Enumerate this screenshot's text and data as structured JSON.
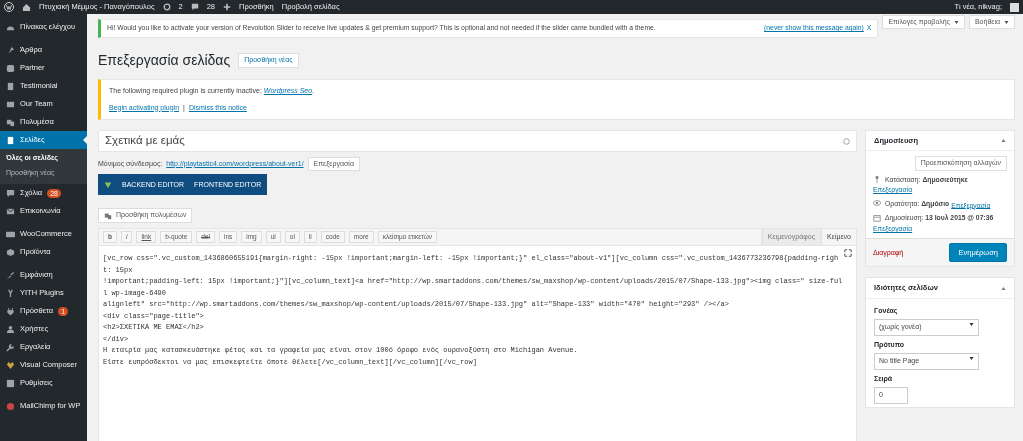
{
  "admin_bar": {
    "site_title": "Πτυχιακή Μέμμος - Παναγόπουλος",
    "updates": "2",
    "comments": "28",
    "new_label": "Προσθήκη",
    "view_label": "Προβολή σελίδας",
    "greeting": "Τι νέα, nikvag;"
  },
  "sidebar": {
    "items": [
      {
        "label": "Πίνακας ελέγχου",
        "selected": false
      },
      {
        "label": "Άρθρα",
        "selected": false
      },
      {
        "label": "Partner",
        "selected": false
      },
      {
        "label": "Testimonial",
        "selected": false
      },
      {
        "label": "Our Team",
        "selected": false
      },
      {
        "label": "Πολυμέσα",
        "selected": false
      },
      {
        "label": "Σελίδες",
        "selected": true,
        "children": [
          {
            "label": "Όλες οι σελίδες",
            "selected": true
          },
          {
            "label": "Προσθήκη νέας",
            "selected": false
          }
        ]
      },
      {
        "label": "Σχόλια",
        "selected": false,
        "badge": "28"
      },
      {
        "label": "Επικοινωνία",
        "selected": false
      },
      {
        "label": "WooCommerce",
        "selected": false
      },
      {
        "label": "Προϊόντα",
        "selected": false
      },
      {
        "label": "Εμφάνιση",
        "selected": false
      },
      {
        "label": "YITH Plugins",
        "selected": false
      },
      {
        "label": "Πρόσθετα",
        "selected": false,
        "badge": "1"
      },
      {
        "label": "Χρήστες",
        "selected": false
      },
      {
        "label": "Εργαλεία",
        "selected": false
      },
      {
        "label": "Visual Composer",
        "selected": false
      },
      {
        "label": "Ρυθμίσεις",
        "selected": false
      },
      {
        "label": "MailChimp for WP",
        "selected": false
      }
    ]
  },
  "slider_notice": {
    "text": "Hi! Would you like to activate your version of Revolution Slider to receive live updates & get premium support? This is optional and not needed if the slider came bundled with a theme.",
    "dismiss_link": "(never show this message again)",
    "close": "X"
  },
  "screen_options": "Επιλογές προβολής",
  "help": "Βοήθεια",
  "heading": "Επεξεργασία σελίδας",
  "add_new": "Προσθήκη νέας",
  "plugin_notice": {
    "text": "The following required plugin is currently inactive: ",
    "plugin_link": "Wordpress Seo",
    "text_end": ".",
    "begin_link": "Begin activating plugin",
    "separator": "|",
    "dismiss_link": "Dismiss this notice"
  },
  "title_value": "Σχετικά με εμάς",
  "permalink": {
    "label": "Μόνιμος σύνδεσμος:",
    "url": "http://playtastic4.com/wordpress/about-ver1/",
    "edit": "Επεξεργασία"
  },
  "composer_tabs": [
    "BACKEND EDITOR",
    "FRONTEND EDITOR"
  ],
  "add_media": "Προσθήκη πολυμέσων",
  "quicktags": [
    "b",
    "i",
    "link",
    "b-quote",
    "del",
    "ins",
    "img",
    "ul",
    "ol",
    "li",
    "code",
    "more",
    "κλείσιμο ετικετών"
  ],
  "editor_tabs": [
    {
      "label": "Κειμενογράφος",
      "selected": false
    },
    {
      "label": "Κείμενο",
      "selected": true
    }
  ],
  "editor_lines": [
    "[vc_row css=\".vc_custom_1436860655191{margin-right: -15px !important;margin-left: -15px !important;}\" el_class=\"about-v1\"][vc_column css=\".vc_custom_1436773236798{padding-right: 15px",
    "!important;padding-left: 15px !important;}\"][vc_column_text]<a href=\"http://wp.smartaddons.com/themes/sw_maxshop/wp-content/uploads/2015/07/Shape-133.jpg\"><img class=\" size-full wp-image-6490",
    "alignleft\" src=\"http://wp.smartaddons.com/themes/sw_maxshop/wp-content/uploads/2015/07/Shape-133.jpg\" alt=\"Shape-133\" width=\"470\" height=\"293\" /></a>",
    "<div class=\"page-title\">",
    "<h2>ΣΧΕΤΙΚΑ ΜΕ ΕΜΑΣ</h2>",
    "</div>",
    "Η εταιρία μας κατασκευάστηκε φέτος και τα γραφεία μας είναι στον 100ό όροφο ενός ουρανοξύστη στο Michigan Avenue.",
    "Είστε ευπρόσδεκτοι να μας επισκεφτείτε όποτε θέλετε[/vc_column_text][/vc_column][/vc_row]"
  ],
  "publish_box": {
    "title": "Δημοσίευση",
    "preview": "Προεπισκόπηση αλλαγών",
    "rows": [
      {
        "label": "Κατάσταση:",
        "value": "Δημοσιεύτηκε",
        "edit": "Επεξεργασία"
      },
      {
        "label": "Ορατότητα:",
        "value": "Δημόσιο",
        "edit": "Επεξεργασία"
      },
      {
        "label": "Δημοσίευση:",
        "value": "13 Ιουλ 2015 @ 07:36",
        "edit": "Επεξεργασία"
      }
    ],
    "delete": "Διαγραφή",
    "update": "Ενημέρωση"
  },
  "attributes_box": {
    "title": "Ιδιότητες σελίδων",
    "parent_label": "Γονέας",
    "parent_value": "(χωρίς γονέα)",
    "template_label": "Πρότυπο",
    "template_value": "No title Page",
    "order_label": "Σειρά",
    "order_value": "0"
  }
}
